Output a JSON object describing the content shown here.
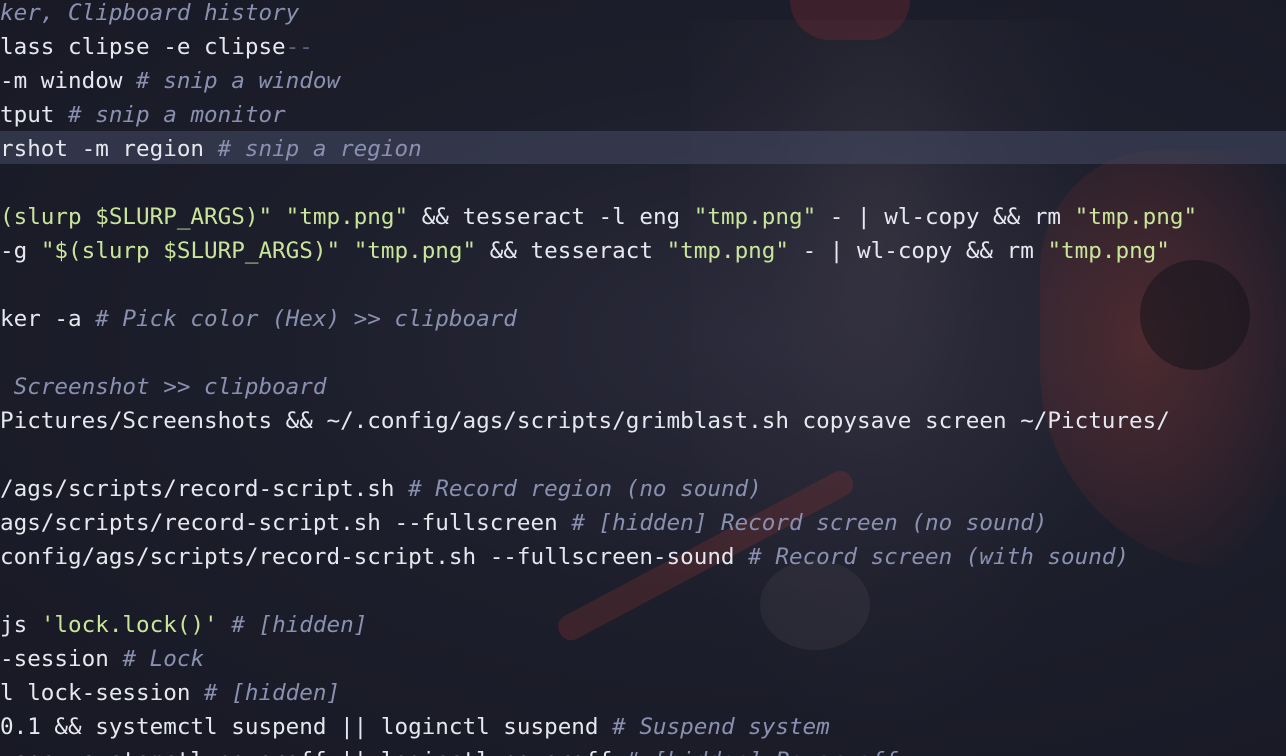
{
  "editor": {
    "current_line_index": 4,
    "lines": [
      [
        {
          "t": "ker, Clipboard history",
          "k": "comment"
        }
      ],
      [
        {
          "t": "lass clipse -e clipse",
          "k": "text"
        },
        {
          "t": "--",
          "k": "dim"
        }
      ],
      [
        {
          "t": "-m window ",
          "k": "text"
        },
        {
          "t": "# snip a window",
          "k": "comment"
        }
      ],
      [
        {
          "t": "tput ",
          "k": "text"
        },
        {
          "t": "# snip a monitor",
          "k": "comment"
        }
      ],
      [
        {
          "t": "rshot -m region ",
          "k": "text"
        },
        {
          "t": "# snip a region",
          "k": "comment"
        }
      ],
      [],
      [
        {
          "t": "(slurp $SLURP_ARGS)\" ",
          "k": "str"
        },
        {
          "t": "\"tmp.png\"",
          "k": "str"
        },
        {
          "t": " && tesseract -l eng ",
          "k": "text"
        },
        {
          "t": "\"tmp.png\"",
          "k": "str"
        },
        {
          "t": " - | wl-copy && rm ",
          "k": "text"
        },
        {
          "t": "\"tmp.png\"",
          "k": "str"
        }
      ],
      [
        {
          "t": "-g ",
          "k": "text"
        },
        {
          "t": "\"$(slurp $SLURP_ARGS)\"",
          "k": "str"
        },
        {
          "t": " ",
          "k": "text"
        },
        {
          "t": "\"tmp.png\"",
          "k": "str"
        },
        {
          "t": " && tesseract ",
          "k": "text"
        },
        {
          "t": "\"tmp.png\"",
          "k": "str"
        },
        {
          "t": " - | wl-copy && rm ",
          "k": "text"
        },
        {
          "t": "\"tmp.png\"",
          "k": "str"
        }
      ],
      [],
      [
        {
          "t": "ker -a ",
          "k": "text"
        },
        {
          "t": "# Pick color (Hex) >> clipboard",
          "k": "comment"
        }
      ],
      [],
      [
        {
          "t": " Screenshot >> clipboard",
          "k": "comment"
        }
      ],
      [
        {
          "t": "Pictures/Screenshots && ~/.config/ags/scripts/grimblast.sh copysave screen ~/Pictures/",
          "k": "text"
        }
      ],
      [],
      [
        {
          "t": "/ags/scripts/record-script.sh ",
          "k": "text"
        },
        {
          "t": "# Record region (no sound)",
          "k": "comment"
        }
      ],
      [
        {
          "t": "ags/scripts/record-script.sh --fullscreen ",
          "k": "text"
        },
        {
          "t": "# [hidden] Record screen (no sound)",
          "k": "comment"
        }
      ],
      [
        {
          "t": "config/ags/scripts/record-script.sh --fullscreen-sound ",
          "k": "text"
        },
        {
          "t": "# Record screen (with sound)",
          "k": "comment"
        }
      ],
      [],
      [
        {
          "t": "js ",
          "k": "text"
        },
        {
          "t": "'lock.lock()'",
          "k": "str"
        },
        {
          "t": " ",
          "k": "text"
        },
        {
          "t": "# [hidden]",
          "k": "comment"
        }
      ],
      [
        {
          "t": "-session ",
          "k": "text"
        },
        {
          "t": "# Lock",
          "k": "comment"
        }
      ],
      [
        {
          "t": "l lock-session ",
          "k": "text"
        },
        {
          "t": "# [hidden]",
          "k": "comment"
        }
      ],
      [
        {
          "t": "0.1 && systemctl suspend || loginctl suspend ",
          "k": "text"
        },
        {
          "t": "# Suspend system",
          "k": "comment"
        }
      ],
      [
        {
          "t": "ysec; systemctl poweroff || loginctl poweroff ",
          "k": "text"
        },
        {
          "t": "# [hidden] Power off",
          "k": "comment"
        }
      ]
    ]
  },
  "colors": {
    "text": "#e6e8ef",
    "string": "#c9e59a",
    "comment": "#8a90b0",
    "background": "#1b1c28",
    "current_line": "#3c4260"
  }
}
